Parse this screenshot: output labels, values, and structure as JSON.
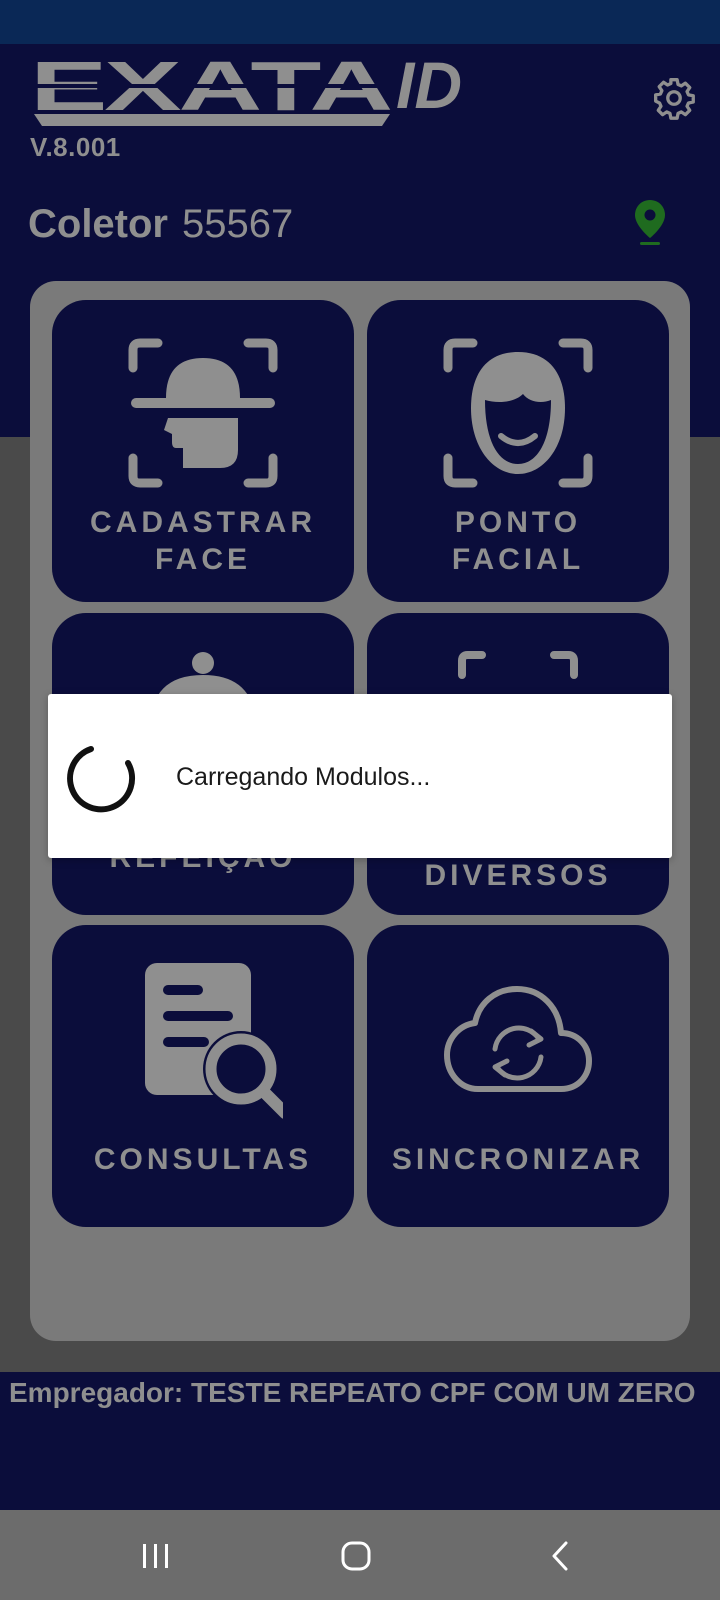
{
  "app": {
    "logo_text": "EXATA",
    "logo_suffix": "ID",
    "version": "V.8.001"
  },
  "collector": {
    "label": "Coletor",
    "number": "55567"
  },
  "tiles": [
    {
      "label_line1": "CADASTRAR",
      "label_line2": "FACE",
      "icon": "face-register-icon"
    },
    {
      "label_line1": "PONTO",
      "label_line2": "FACIAL",
      "icon": "face-punch-icon"
    },
    {
      "label_line1": "REFEIÇÃO",
      "label_line2": "",
      "icon": "meal-cloche-icon"
    },
    {
      "label_line1": "DIVERSOS",
      "label_line2": "",
      "icon": "misc-scan-icon"
    },
    {
      "label_line1": "CONSULTAS",
      "label_line2": "",
      "icon": "document-search-icon"
    },
    {
      "label_line1": "SINCRONIZAR",
      "label_line2": "",
      "icon": "cloud-sync-icon"
    }
  ],
  "footer": {
    "employer": "Empregador: TESTE REPEATO CPF COM UM ZERO"
  },
  "dialog": {
    "message": "Carregando Modulos..."
  },
  "colors": {
    "header": "#0b0d3b",
    "status_bar": "#0a2856",
    "text_muted": "#8f8f8f",
    "pin": "#1f6b1f"
  }
}
